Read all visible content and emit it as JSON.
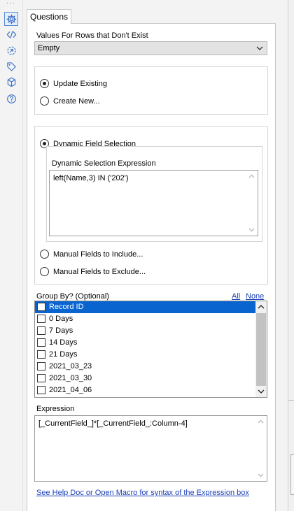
{
  "tab": {
    "label": "Questions"
  },
  "rail": {
    "items": [
      {
        "icon": "gear-icon"
      },
      {
        "icon": "code-icon"
      },
      {
        "icon": "connection-icon"
      },
      {
        "icon": "tag-icon"
      },
      {
        "icon": "cube-icon"
      },
      {
        "icon": "help-icon"
      }
    ]
  },
  "missing_rows": {
    "label": "Values For Rows that Don't Exist",
    "selected": "Empty"
  },
  "output_mode": {
    "update_existing": "Update Existing",
    "create_new": "Create New...",
    "selected": "update_existing"
  },
  "field_selection": {
    "dynamic": "Dynamic Field Selection",
    "expression_label": "Dynamic Selection Expression",
    "expression_value": "left(Name,3) IN ('202')",
    "manual_include": "Manual Fields to Include...",
    "manual_exclude": "Manual Fields to Exclude...",
    "selected": "dynamic"
  },
  "group_by": {
    "label": "Group By? (Optional)",
    "all_link": "All",
    "none_link": "None",
    "fields": [
      "Record ID",
      "0 Days",
      "7 Days",
      "14 Days",
      "21 Days",
      "2021_03_23",
      "2021_03_30",
      "2021_04_06"
    ],
    "selected_index": 0
  },
  "expression": {
    "label": "Expression",
    "value": "[_CurrentField_]*[_CurrentField_:Column-4]"
  },
  "help_link": "See Help Doc or Open Macro for syntax of the Expression box"
}
